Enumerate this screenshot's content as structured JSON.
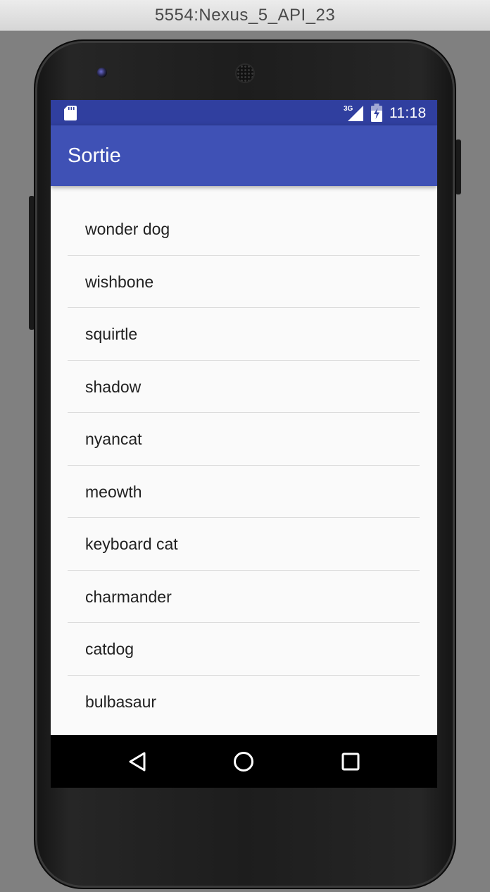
{
  "window": {
    "title": "5554:Nexus_5_API_23"
  },
  "status_bar": {
    "network_label": "3G",
    "time": "11:18",
    "icons": [
      "sd-card-icon",
      "signal-icon",
      "battery-charging-icon"
    ]
  },
  "app_bar": {
    "title": "Sortie"
  },
  "list": {
    "items": [
      {
        "label": "wonder dog"
      },
      {
        "label": "wishbone"
      },
      {
        "label": "squirtle"
      },
      {
        "label": "shadow"
      },
      {
        "label": "nyancat"
      },
      {
        "label": "meowth"
      },
      {
        "label": "keyboard cat"
      },
      {
        "label": "charmander"
      },
      {
        "label": "catdog"
      },
      {
        "label": "bulbasaur"
      }
    ]
  },
  "nav_bar": {
    "buttons": [
      "back-icon",
      "home-icon",
      "recents-icon"
    ]
  },
  "colors": {
    "status_bar": "#303f9f",
    "app_bar": "#3f51b5",
    "list_background": "#fafafa",
    "nav_bar": "#000000"
  }
}
